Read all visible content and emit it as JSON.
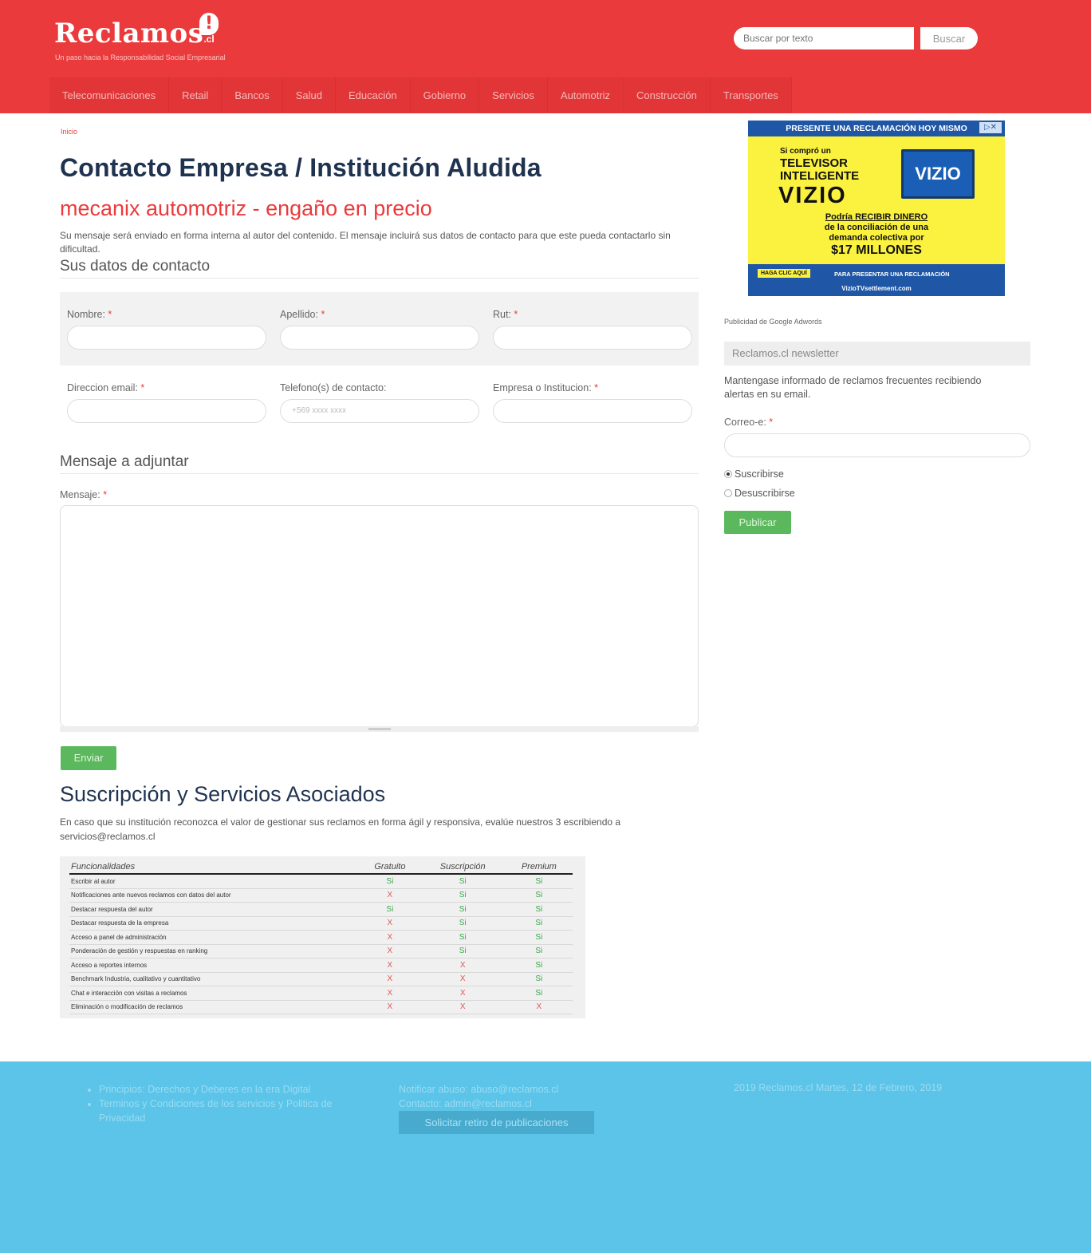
{
  "header": {
    "logo_text": "Reclamos",
    "logo_cl": ".cl",
    "logo_mark": "!",
    "tagline": "Un paso hacia la Responsabilidad Social Empresarial",
    "search_placeholder": "Buscar por texto",
    "search_button": "Buscar"
  },
  "nav": [
    "Telecomunicaciones",
    "Retail",
    "Bancos",
    "Salud",
    "Educación",
    "Gobierno",
    "Servicios",
    "Automotriz",
    "Construcción",
    "Transportes"
  ],
  "breadcrumb": "Inicio",
  "page_title": "Contacto Empresa / Institución Aludida",
  "subtitle": "mecanix automotriz - engaño en precio",
  "intro": "Su mensaje será enviado en forma interna al autor del contenido. El mensaje incluirá sus datos de contacto para que este pueda contactarlo sin dificultad.",
  "contact_heading": "Sus datos de contacto",
  "fields": {
    "nombre": "Nombre:",
    "apellido": "Apellido:",
    "rut": "Rut:",
    "email": "Direccion email:",
    "telefono": "Telefono(s) de contacto:",
    "telefono_placeholder": "+569 xxxx xxxx",
    "empresa": "Empresa o Institucion:",
    "required_mark": "*"
  },
  "message_heading": "Mensaje a adjuntar",
  "message_label": "Mensaje:",
  "send_button": "Enviar",
  "subscription": {
    "title": "Suscripción y Servicios Asociados",
    "text": "En caso que su institución reconozca el valor de gestionar sus reclamos en forma ágil y responsiva, evalúe nuestros 3 escribiendo a servicios@reclamos.cl",
    "headers": [
      "Funcionalidades",
      "Gratuito",
      "Suscripción",
      "Premium"
    ],
    "rows": [
      [
        "Escribir al autor",
        "Si",
        "Si",
        "Si"
      ],
      [
        "Notificaciones ante nuevos reclamos con datos del autor",
        "X",
        "Si",
        "Si"
      ],
      [
        "Destacar respuesta del autor",
        "Si",
        "Si",
        "Si"
      ],
      [
        "Destacar respuesta de la empresa",
        "X",
        "Si",
        "Si"
      ],
      [
        "Acceso a panel de administración",
        "X",
        "Si",
        "Si"
      ],
      [
        "Ponderación de gestión y respuestas en ranking",
        "X",
        "Si",
        "Si"
      ],
      [
        "Acceso a reportes internos",
        "X",
        "X",
        "Si"
      ],
      [
        "Benchmark Industria, cualitativo y cuantitativo",
        "X",
        "X",
        "Si"
      ],
      [
        "Chat e interacción con visitas a reclamos",
        "X",
        "X",
        "Si"
      ],
      [
        "Eliminación o modificación de reclamos",
        "X",
        "X",
        "X"
      ]
    ]
  },
  "ad": {
    "top": "PRESENTE UNA RECLAMACIÓN HOY MISMO",
    "line1": "Si compró un",
    "line2a": "TELEVISOR",
    "line2b": "INTELIGENTE",
    "brand": "VIZIO",
    "tv_logo": "VIZIO",
    "body1": "Podría RECIBIR DINERO",
    "body2": "de la conciliación de una",
    "body3": "demanda colectiva por",
    "amount": "$17 MILLONES",
    "cta": "HAGA CLIC AQUÍ",
    "cta2": "PARA PRESENTAR UNA RECLAMACIÓN",
    "url": "VizioTVsettlement.com",
    "close": "▷✕"
  },
  "sidebar": {
    "adwords": "Publicidad de Google Adwords",
    "newsletter_title": "Reclamos.cl newsletter",
    "newsletter_text": "Mantengase informado de reclamos frecuentes recibiendo alertas en su email.",
    "email_label": "Correo-e:",
    "subscribe": "Suscribirse",
    "unsubscribe": "Desuscribirse",
    "publish_button": "Publicar"
  },
  "footer": {
    "links": [
      "Principios: Derechos y Deberes en la era Digital",
      "Terminos y Condiciones de los servicios y Politica de Privacidad"
    ],
    "abuse": "Notificar abuso: abuso@reclamos.cl",
    "contact": "Contacto: admin@reclamos.cl",
    "withdraw_button": "Solicitar retiro de publicaciones",
    "copyright": "2019 Reclamos.cl Martes, 12 de Febrero, 2019"
  },
  "colors": {
    "header": "#ea3a3c",
    "footer": "#5bc4e8",
    "button": "#5cb85c",
    "title": "#1f3350"
  }
}
